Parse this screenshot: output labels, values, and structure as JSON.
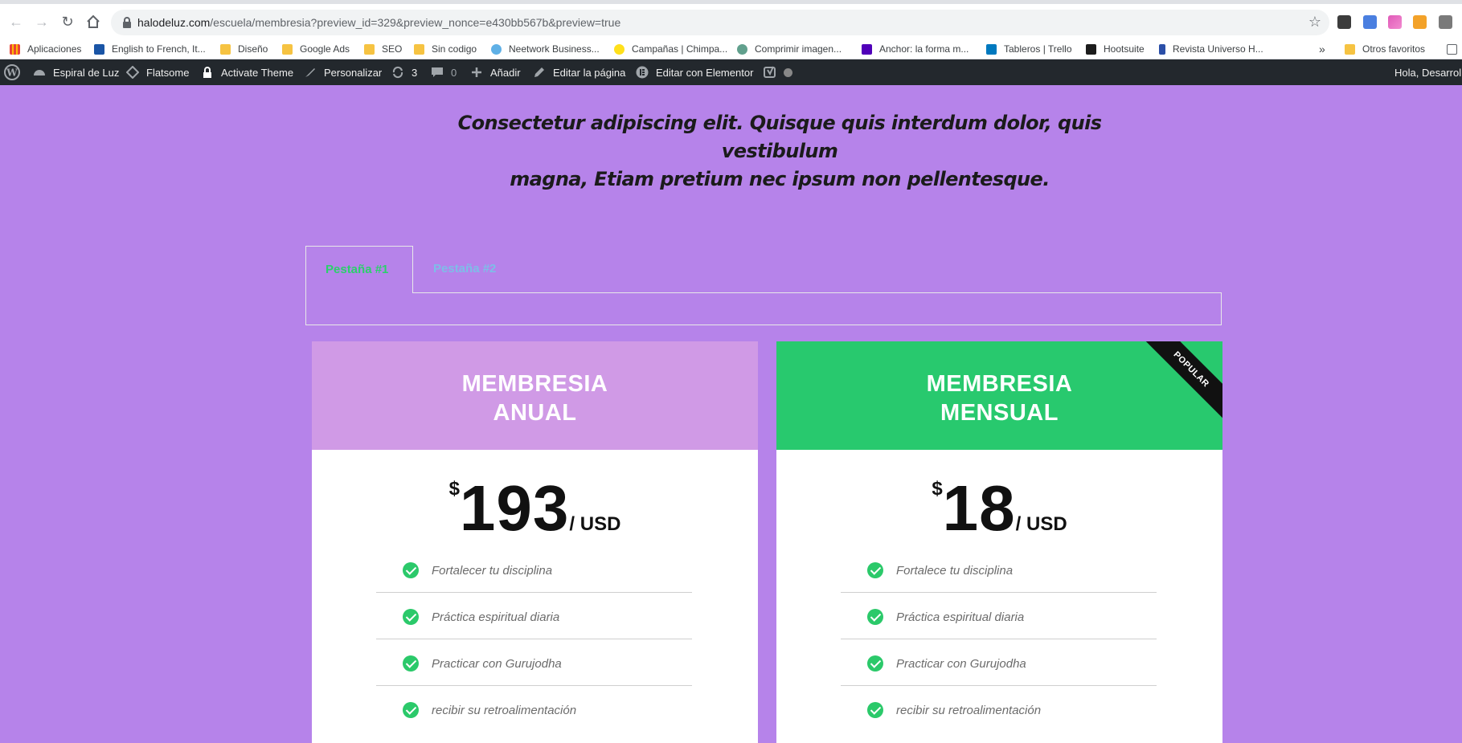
{
  "browser": {
    "url_host": "halodeluz.com",
    "url_path": "/escuela/membresia?preview_id=329&preview_nonce=e430bb567b&preview=true"
  },
  "bookmarks": {
    "items": [
      {
        "label": "Aplicaciones",
        "icon": "apps-grid-icon"
      },
      {
        "label": "English to French, It...",
        "icon": "wordreference-icon"
      },
      {
        "label": "Diseño",
        "icon": "folder-icon"
      },
      {
        "label": "Google Ads",
        "icon": "folder-icon"
      },
      {
        "label": "SEO",
        "icon": "folder-icon"
      },
      {
        "label": "Sin codigo",
        "icon": "folder-icon"
      },
      {
        "label": "Neetwork Business...",
        "icon": "neetwork-icon"
      },
      {
        "label": "Campañas | Chimpa...",
        "icon": "mailchimp-icon"
      },
      {
        "label": "Comprimir imagen...",
        "icon": "tinypng-icon"
      },
      {
        "label": "Anchor: la forma m...",
        "icon": "anchor-icon"
      },
      {
        "label": "Tableros | Trello",
        "icon": "trello-icon"
      },
      {
        "label": "Hootsuite",
        "icon": "hootsuite-icon"
      },
      {
        "label": "Revista Universo H...",
        "icon": "revista-icon"
      }
    ],
    "more": "»",
    "other": "Otros favoritos"
  },
  "adminbar": {
    "site": "Espiral de Luz",
    "theme": "Flatsome",
    "activate": "Activate Theme",
    "customize": "Personalizar",
    "updates": "3",
    "comments": "0",
    "add": "Añadir",
    "edit_page": "Editar la página",
    "elementor": "Editar con Elementor",
    "greeting": "Hola, Desarroll"
  },
  "page": {
    "subtitle_line1": "Consectetur adipiscing elit. Quisque quis interdum dolor, quis vestibulum",
    "subtitle_line2": "magna, Etiam pretium nec ipsum non pellentesque.",
    "tabs": [
      {
        "label": "Pestaña #1",
        "active": true
      },
      {
        "label": "Pestaña #2",
        "active": false
      }
    ],
    "plans": [
      {
        "title_line1": "MEMBRESIA",
        "title_line2": "ANUAL",
        "currency": "$",
        "amount": "193",
        "period": "/ USD",
        "header_color": "#d09ae6",
        "ribbon": "",
        "features": [
          "Fortalecer tu disciplina",
          "Práctica espiritual diaria",
          "Practicar con Gurujodha",
          "recibir su retroalimentación"
        ]
      },
      {
        "title_line1": "MEMBRESIA",
        "title_line2": "MENSUAL",
        "currency": "$",
        "amount": "18",
        "period": "/ USD",
        "header_color": "#28c96e",
        "ribbon": "POPULAR",
        "features": [
          "Fortalece tu disciplina",
          "Práctica espiritual diaria",
          "Practicar con Gurujodha",
          "recibir su retroalimentación"
        ]
      }
    ]
  },
  "colors": {
    "page_bg": "#b683ea",
    "adminbar_bg": "#23282d",
    "check": "#2bc96a",
    "tab_active": "#2bd06b",
    "tab_inactive": "#7ebde8"
  }
}
